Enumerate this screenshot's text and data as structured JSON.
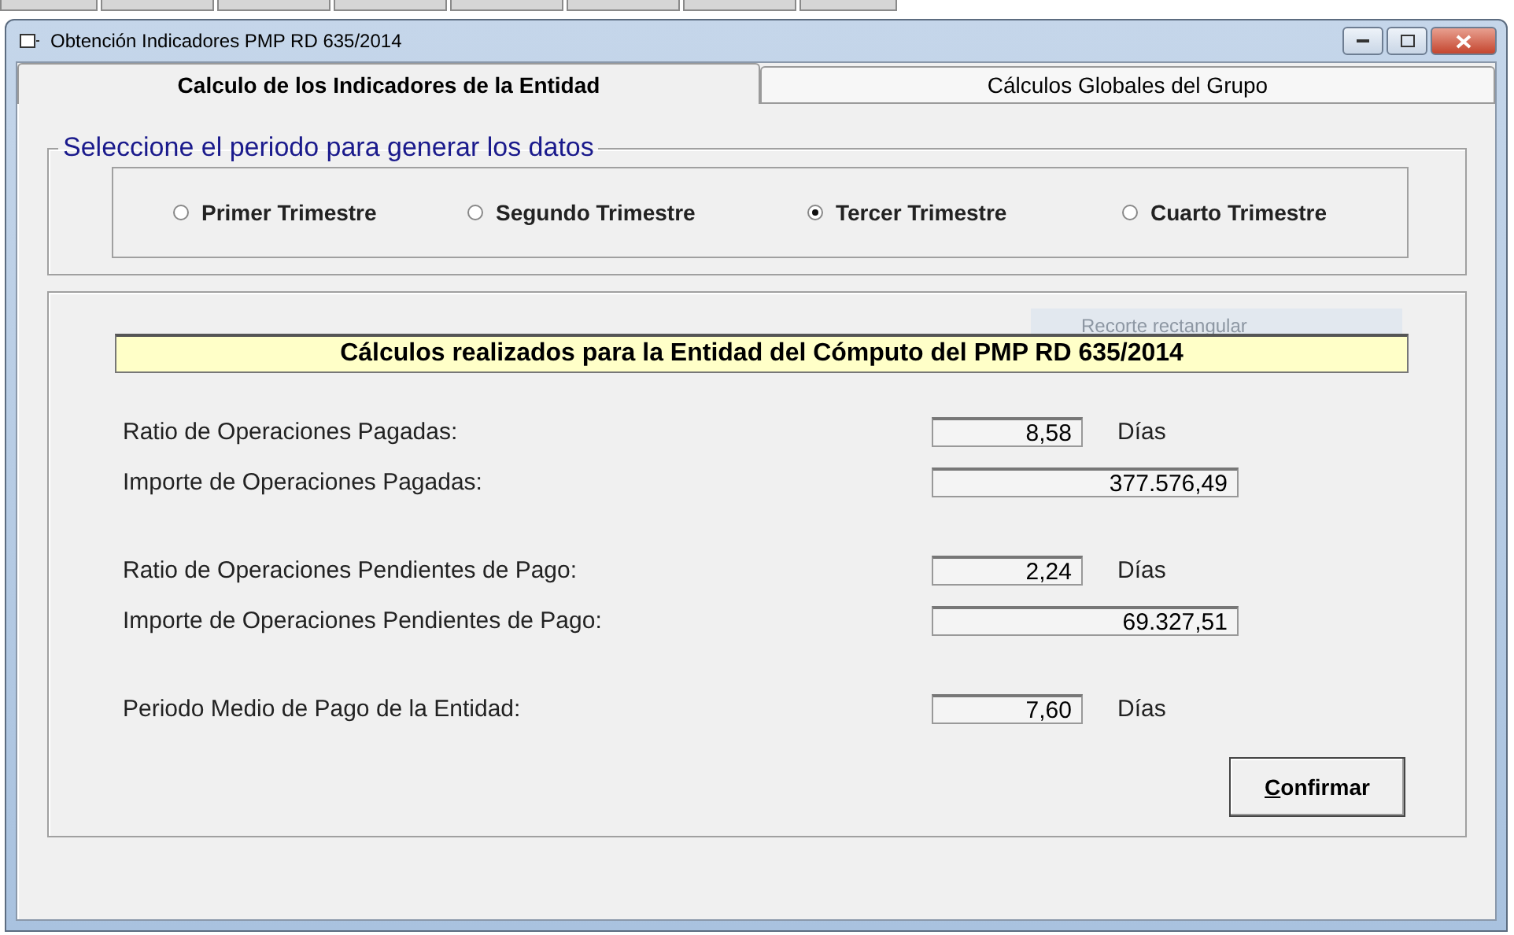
{
  "window": {
    "title": "Obtención Indicadores PMP RD 635/2014"
  },
  "tabs": [
    {
      "label": "Calculo de los Indicadores de la Entidad",
      "selected": true
    },
    {
      "label": "Cálculos Globales del Grupo",
      "selected": false
    }
  ],
  "period_group": {
    "title": "Seleccione el periodo para generar los datos",
    "options": [
      {
        "label": "Primer Trimestre",
        "selected": false
      },
      {
        "label": "Segundo Trimestre",
        "selected": false
      },
      {
        "label": "Tercer Trimestre",
        "selected": true
      },
      {
        "label": "Cuarto Trimestre",
        "selected": false
      }
    ]
  },
  "tooltip_ghost": {
    "text": "Recorte rectangular"
  },
  "results": {
    "header": "Cálculos realizados para la Entidad del Cómputo del PMP RD 635/2014",
    "rows": [
      {
        "kind": "short",
        "label": "Ratio de Operaciones Pagadas:",
        "value": "8,58",
        "unit": "Días"
      },
      {
        "kind": "long",
        "label": "Importe de Operaciones Pagadas:",
        "value": "377.576,49"
      },
      {
        "kind": "spacer"
      },
      {
        "kind": "short",
        "label": "Ratio de Operaciones Pendientes de Pago:",
        "value": "2,24",
        "unit": "Días"
      },
      {
        "kind": "long",
        "label": "Importe de Operaciones Pendientes de Pago:",
        "value": "69.327,51"
      },
      {
        "kind": "spacer"
      },
      {
        "kind": "short",
        "label": "Periodo Medio de Pago de la Entidad:",
        "value": "7,60",
        "unit": "Días"
      }
    ]
  },
  "confirm_button": {
    "label": "Confirmar"
  }
}
